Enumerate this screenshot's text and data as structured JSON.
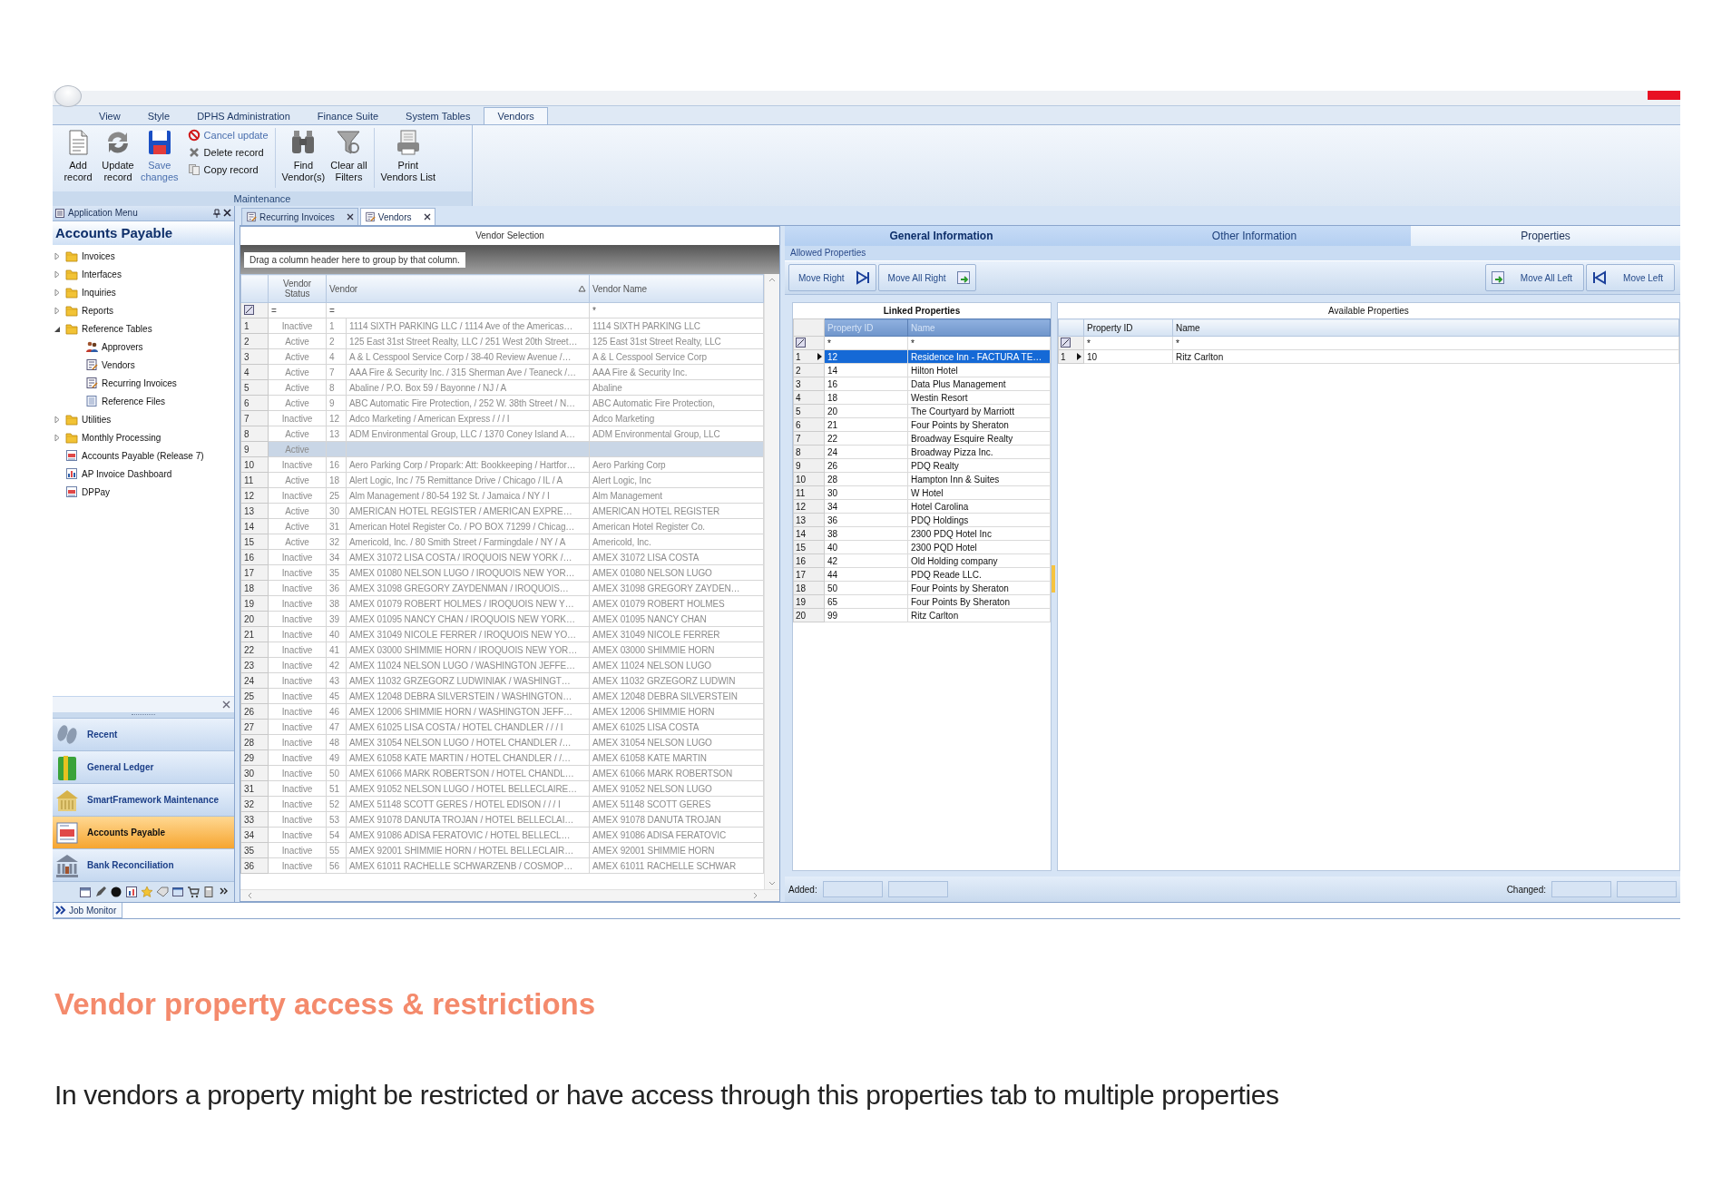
{
  "ribbon": {
    "tabs": [
      {
        "label": "View",
        "selected": false
      },
      {
        "label": "Style",
        "selected": false
      },
      {
        "label": "DPHS Administration",
        "selected": false
      },
      {
        "label": "Finance Suite",
        "selected": false
      },
      {
        "label": "System Tables",
        "selected": false
      },
      {
        "label": "Vendors",
        "selected": true
      }
    ],
    "group_label": "Maintenance",
    "sections": [
      [
        {
          "kind": "large",
          "label": "Add\nrecord",
          "disabled": false
        },
        {
          "kind": "large",
          "label": "Update\nrecord",
          "disabled": false
        },
        {
          "kind": "large",
          "label": "Save\nchanges",
          "disabled": true
        },
        {
          "kind": "small",
          "label": "Cancel update",
          "disabled": true
        },
        {
          "kind": "small",
          "label": "Delete record",
          "disabled": false
        },
        {
          "kind": "small",
          "label": "Copy record",
          "disabled": false
        }
      ],
      [
        {
          "kind": "large",
          "label": "Find\nVendor(s)",
          "disabled": false
        },
        {
          "kind": "large",
          "label": "Clear all\nFilters",
          "disabled": false
        }
      ],
      [
        {
          "kind": "large",
          "label": "Print\nVendors List",
          "disabled": false
        }
      ]
    ]
  },
  "sidebar": {
    "title": "Application Menu",
    "heading": "Accounts Payable",
    "tree": [
      {
        "kind": "folder",
        "label": "Invoices",
        "expanded": false
      },
      {
        "kind": "folder",
        "label": "Interfaces",
        "expanded": false
      },
      {
        "kind": "folder",
        "label": "Inquiries",
        "expanded": false
      },
      {
        "kind": "folder",
        "label": "Reports",
        "expanded": false
      },
      {
        "kind": "folder",
        "label": "Reference Tables",
        "expanded": true,
        "children": [
          {
            "kind": "people",
            "label": "Approvers"
          },
          {
            "kind": "form",
            "label": "Vendors"
          },
          {
            "kind": "form",
            "label": "Recurring Invoices"
          },
          {
            "kind": "list",
            "label": "Reference Files"
          }
        ]
      },
      {
        "kind": "folder",
        "label": "Utilities",
        "expanded": false
      },
      {
        "kind": "folder",
        "label": "Monthly Processing",
        "expanded": false
      },
      {
        "kind": "report",
        "label": "Accounts Payable (Release 7)"
      },
      {
        "kind": "chart",
        "label": "AP Invoice Dashboard"
      },
      {
        "kind": "report",
        "label": "DPPay"
      }
    ],
    "nav": [
      {
        "label": "Recent",
        "selected": false
      },
      {
        "label": "General Ledger",
        "selected": false
      },
      {
        "label": "SmartFramework Maintenance",
        "selected": false
      },
      {
        "label": "Accounts Payable",
        "selected": true
      },
      {
        "label": "Bank Reconciliation",
        "selected": false
      }
    ]
  },
  "doc_tabs": [
    {
      "label": "Recurring Invoices",
      "selected": false
    },
    {
      "label": "Vendors",
      "selected": true
    }
  ],
  "vendor_grid": {
    "title": "Vendor Selection",
    "group_hint": "Drag a column header here to group by that column.",
    "columns": [
      {
        "label": "Vendor Status",
        "sorted": false
      },
      {
        "label": "Vendor",
        "sorted": true
      },
      {
        "label": "Vendor Name",
        "sorted": false
      }
    ],
    "filters": [
      "=",
      "=",
      "*"
    ],
    "rows": [
      {
        "num": "1",
        "status": "Inactive",
        "id": "1",
        "vendor": "1114 SIXTH PARKING LLC / 1114 Ave of the Americas…",
        "name": "1114 SIXTH PARKING LLC",
        "selected": false
      },
      {
        "num": "2",
        "status": "Active",
        "id": "2",
        "vendor": "125 East 31st Street Realty, LLC / 251 West 20th Street…",
        "name": "125 East 31st Street Realty, LLC",
        "selected": false
      },
      {
        "num": "3",
        "status": "Active",
        "id": "4",
        "vendor": "A & L Cesspool Service Corp / 38-40 Review Avenue /…",
        "name": "A & L Cesspool Service Corp",
        "selected": false
      },
      {
        "num": "4",
        "status": "Active",
        "id": "7",
        "vendor": "AAA Fire & Security Inc. / 315 Sherman Ave / Teaneck /…",
        "name": "AAA Fire & Security Inc.",
        "selected": false
      },
      {
        "num": "5",
        "status": "Active",
        "id": "8",
        "vendor": "Abaline / P.O. Box 59 / Bayonne / NJ / A",
        "name": "Abaline",
        "selected": false
      },
      {
        "num": "6",
        "status": "Active",
        "id": "9",
        "vendor": "ABC Automatic Fire Protection, / 252 W. 38th Street / N…",
        "name": "ABC Automatic Fire Protection,",
        "selected": false
      },
      {
        "num": "7",
        "status": "Inactive",
        "id": "12",
        "vendor": "Adco Marketing / American Express / / / I",
        "name": "Adco Marketing",
        "selected": false
      },
      {
        "num": "8",
        "status": "Active",
        "id": "13",
        "vendor": "ADM Environmental Group, LLC / 1370 Coney Island A…",
        "name": "ADM Environmental Group, LLC",
        "selected": false
      },
      {
        "num": "9",
        "status": "Active",
        "selected": true
      },
      {
        "num": "10",
        "status": "Inactive",
        "id": "16",
        "vendor": "Aero Parking Corp / Propark: Att: Bookkeeping / Hartfor…",
        "name": "Aero Parking Corp",
        "selected": false
      },
      {
        "num": "11",
        "status": "Active",
        "id": "18",
        "vendor": "Alert Logic, Inc / 75 Remittance Drive / Chicago / IL / A",
        "name": "Alert Logic, Inc",
        "selected": false
      },
      {
        "num": "12",
        "status": "Inactive",
        "id": "25",
        "vendor": "Alm Management / 80-54 192 St. / Jamaica / NY / I",
        "name": "Alm Management",
        "selected": false
      },
      {
        "num": "13",
        "status": "Active",
        "id": "30",
        "vendor": "AMERICAN HOTEL REGISTER / AMERICAN EXPRE…",
        "name": "AMERICAN HOTEL REGISTER",
        "selected": false
      },
      {
        "num": "14",
        "status": "Active",
        "id": "31",
        "vendor": "American Hotel Register Co. / PO BOX 71299 / Chicag…",
        "name": "American Hotel Register Co.",
        "selected": false
      },
      {
        "num": "15",
        "status": "Active",
        "id": "32",
        "vendor": "Americold, Inc. / 80 Smith Street / Farmingdale / NY / A",
        "name": "Americold, Inc.",
        "selected": false
      },
      {
        "num": "16",
        "status": "Inactive",
        "id": "34",
        "vendor": "AMEX 31072 LISA COSTA / IROQUOIS NEW YORK /…",
        "name": "AMEX 31072 LISA COSTA",
        "selected": false
      },
      {
        "num": "17",
        "status": "Inactive",
        "id": "35",
        "vendor": "AMEX 01080 NELSON LUGO / IROQUOIS NEW YOR…",
        "name": "AMEX 01080 NELSON LUGO",
        "selected": false
      },
      {
        "num": "18",
        "status": "Inactive",
        "id": "36",
        "vendor": "AMEX 31098 GREGORY ZAYDENMAN / IROQUOIS…",
        "name": "AMEX 31098 GREGORY ZAYDEN…",
        "selected": false
      },
      {
        "num": "19",
        "status": "Inactive",
        "id": "38",
        "vendor": "AMEX 01079 ROBERT HOLMES / IROQUOIS NEW Y…",
        "name": "AMEX 01079 ROBERT HOLMES",
        "selected": false
      },
      {
        "num": "20",
        "status": "Inactive",
        "id": "39",
        "vendor": "AMEX 01095 NANCY CHAN / IROQUOIS NEW YORK…",
        "name": "AMEX 01095 NANCY CHAN",
        "selected": false
      },
      {
        "num": "21",
        "status": "Inactive",
        "id": "40",
        "vendor": "AMEX 31049 NICOLE FERRER / IROQUOIS NEW YO…",
        "name": "AMEX 31049 NICOLE FERRER",
        "selected": false
      },
      {
        "num": "22",
        "status": "Inactive",
        "id": "41",
        "vendor": "AMEX 03000 SHIMMIE HORN / IROQUOIS NEW YOR…",
        "name": "AMEX 03000 SHIMMIE HORN",
        "selected": false
      },
      {
        "num": "23",
        "status": "Inactive",
        "id": "42",
        "vendor": "AMEX 11024 NELSON LUGO / WASHINGTON JEFFE…",
        "name": "AMEX 11024 NELSON LUGO",
        "selected": false
      },
      {
        "num": "24",
        "status": "Inactive",
        "id": "43",
        "vendor": "AMEX 11032 GRZEGORZ LUDWINIAK / WASHINGT…",
        "name": "AMEX 11032 GRZEGORZ LUDWIN",
        "selected": false
      },
      {
        "num": "25",
        "status": "Inactive",
        "id": "45",
        "vendor": "AMEX 12048 DEBRA SILVERSTEIN / WASHINGTON…",
        "name": "AMEX 12048 DEBRA SILVERSTEIN",
        "selected": false
      },
      {
        "num": "26",
        "status": "Inactive",
        "id": "46",
        "vendor": "AMEX 12006 SHIMMIE HORN / WASHINGTON JEFF…",
        "name": "AMEX 12006 SHIMMIE HORN",
        "selected": false
      },
      {
        "num": "27",
        "status": "Inactive",
        "id": "47",
        "vendor": "AMEX 61025 LISA COSTA / HOTEL CHANDLER / / / I",
        "name": "AMEX 61025 LISA COSTA",
        "selected": false
      },
      {
        "num": "28",
        "status": "Inactive",
        "id": "48",
        "vendor": "AMEX 31054 NELSON LUGO / HOTEL CHANDLER /…",
        "name": "AMEX 31054 NELSON LUGO",
        "selected": false
      },
      {
        "num": "29",
        "status": "Inactive",
        "id": "49",
        "vendor": "AMEX 61058 KATE MARTIN / HOTEL CHANDLER / /…",
        "name": "AMEX 61058 KATE MARTIN",
        "selected": false
      },
      {
        "num": "30",
        "status": "Inactive",
        "id": "50",
        "vendor": "AMEX 61066 MARK ROBERTSON / HOTEL CHANDL…",
        "name": "AMEX 61066 MARK ROBERTSON",
        "selected": false
      },
      {
        "num": "31",
        "status": "Inactive",
        "id": "51",
        "vendor": "AMEX 91052 NELSON LUGO / HOTEL BELLECLAIRE…",
        "name": "AMEX 91052 NELSON LUGO",
        "selected": false
      },
      {
        "num": "32",
        "status": "Inactive",
        "id": "52",
        "vendor": "AMEX 51148 SCOTT GERES / HOTEL EDISON / / / I",
        "name": "AMEX 51148 SCOTT GERES",
        "selected": false
      },
      {
        "num": "33",
        "status": "Inactive",
        "id": "53",
        "vendor": "AMEX 91078 DANUTA TROJAN / HOTEL BELLECLAI…",
        "name": "AMEX 91078 DANUTA TROJAN",
        "selected": false
      },
      {
        "num": "34",
        "status": "Inactive",
        "id": "54",
        "vendor": "AMEX 91086 ADISA FERATOVIC / HOTEL BELLECL…",
        "name": "AMEX 91086 ADISA FERATOVIC",
        "selected": false
      },
      {
        "num": "35",
        "status": "Inactive",
        "id": "55",
        "vendor": "AMEX 92001 SHIMMIE HORN / HOTEL BELLECLAIR…",
        "name": "AMEX 92001 SHIMMIE HORN",
        "selected": false
      },
      {
        "num": "36",
        "status": "Inactive",
        "id": "56",
        "vendor": "AMEX 61011 RACHELLE SCHWARZENB / COSMOP…",
        "name": "AMEX 61011 RACHELLE SCHWAR",
        "selected": false
      }
    ]
  },
  "details": {
    "tabs": [
      {
        "label": "General Information",
        "selected": false,
        "emphasized": true
      },
      {
        "label": "Other Information",
        "selected": false,
        "emphasized": false
      },
      {
        "label": "Properties",
        "selected": true,
        "emphasized": false
      }
    ],
    "section_label": "Allowed Properties",
    "left_buttons": [
      "Move Right",
      "Move All Right"
    ],
    "right_buttons": [
      "Move All Left",
      "Move Left"
    ],
    "linked": {
      "title": "Linked Properties",
      "header_highlighted": true,
      "columns": [
        "Property ID",
        "Name"
      ],
      "filters": [
        "*",
        "*"
      ],
      "rows": [
        {
          "num": "1",
          "id": "12",
          "name": "Residence Inn - FACTURA TE…",
          "selected": true,
          "current": true
        },
        {
          "num": "2",
          "id": "14",
          "name": "Hilton Hotel",
          "selected": false,
          "current": false
        },
        {
          "num": "3",
          "id": "16",
          "name": "Data Plus Management",
          "selected": false,
          "current": false
        },
        {
          "num": "4",
          "id": "18",
          "name": "Westin Resort",
          "selected": false,
          "current": false
        },
        {
          "num": "5",
          "id": "20",
          "name": "The Courtyard by Marriott",
          "selected": false,
          "current": false
        },
        {
          "num": "6",
          "id": "21",
          "name": "Four Points by Sheraton",
          "selected": false,
          "current": false
        },
        {
          "num": "7",
          "id": "22",
          "name": "Broadway Esquire Realty",
          "selected": false,
          "current": false
        },
        {
          "num": "8",
          "id": "24",
          "name": "Broadway Pizza Inc.",
          "selected": false,
          "current": false
        },
        {
          "num": "9",
          "id": "26",
          "name": "PDQ Realty",
          "selected": false,
          "current": false
        },
        {
          "num": "10",
          "id": "28",
          "name": "Hampton Inn & Suites",
          "selected": false,
          "current": false
        },
        {
          "num": "11",
          "id": "30",
          "name": "W Hotel",
          "selected": false,
          "current": false
        },
        {
          "num": "12",
          "id": "34",
          "name": "Hotel Carolina",
          "selected": false,
          "current": false
        },
        {
          "num": "13",
          "id": "36",
          "name": "PDQ Holdings",
          "selected": false,
          "current": false
        },
        {
          "num": "14",
          "id": "38",
          "name": "2300 PDQ Hotel Inc",
          "selected": false,
          "current": false
        },
        {
          "num": "15",
          "id": "40",
          "name": "2300 PQD Hotel",
          "selected": false,
          "current": false
        },
        {
          "num": "16",
          "id": "42",
          "name": "Old Holding company",
          "selected": false,
          "current": false
        },
        {
          "num": "17",
          "id": "44",
          "name": "PDQ Reade LLC.",
          "selected": false,
          "current": false
        },
        {
          "num": "18",
          "id": "50",
          "name": "Four Points by Sheraton",
          "selected": false,
          "current": false
        },
        {
          "num": "19",
          "id": "65",
          "name": "Four Points By Sheraton",
          "selected": false,
          "current": false
        },
        {
          "num": "20",
          "id": "99",
          "name": "Ritz Carlton",
          "selected": false,
          "current": false
        }
      ]
    },
    "available": {
      "title": "Available Properties",
      "header_highlighted": false,
      "columns": [
        "Property ID",
        "Name"
      ],
      "filters": [
        "*",
        "*"
      ],
      "rows": [
        {
          "num": "1",
          "id": "10",
          "name": "Ritz Carlton",
          "selected": false,
          "current": true
        }
      ]
    },
    "added_label": "Added:",
    "changed_label": "Changed:"
  },
  "job_monitor": "Job Monitor",
  "caption": {
    "title": "Vendor property access & restrictions",
    "text": "In vendors a property might be restricted or have access through this properties tab to multiple properties"
  }
}
